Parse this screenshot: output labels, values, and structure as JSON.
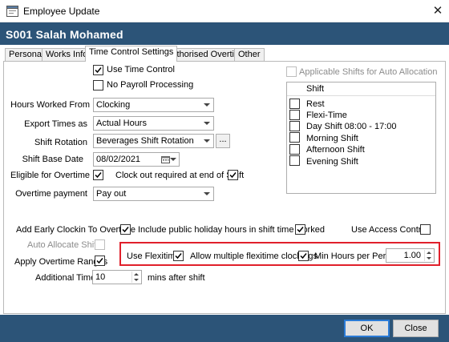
{
  "window": {
    "title": "Employee Update",
    "close_glyph": "✕",
    "icon": "app-window-icon"
  },
  "header": {
    "employee": "S001 Salah Mohamed"
  },
  "tabs": [
    "Personal",
    "Works Info",
    "Time Control Settings",
    "Authorised Overtime",
    "Other"
  ],
  "active_tab": "Time Control Settings",
  "checkboxes": {
    "use_time_control": {
      "label": "Use Time Control",
      "checked": true
    },
    "no_payroll_processing": {
      "label": "No Payroll Processing",
      "checked": false
    },
    "eligible_overtime": {
      "label": "Eligible for Overtime",
      "checked": true
    },
    "clock_out_end_shift": {
      "label": "Clock out required at end of Shift",
      "checked": true
    },
    "add_early_clockin": {
      "label": "Add Early Clockin To Overtime",
      "checked": true
    },
    "include_public_holiday": {
      "label": "Include public holiday hours in shift time worked",
      "checked": true
    },
    "use_access_control": {
      "label": "Use Access Control",
      "checked": false
    },
    "auto_allocate_shifts": {
      "label": "Auto Allocate Shifts",
      "checked": false
    },
    "apply_overtime_ranges": {
      "label": "Apply Overtime Ranges",
      "checked": true
    },
    "use_flexitime": {
      "label": "Use Flexitime",
      "checked": true
    },
    "allow_multiple_flexitime": {
      "label": "Allow multiple flexitime clockings",
      "checked": true
    },
    "applicable_shifts": {
      "label": "Applicable Shifts for Auto Allocation",
      "checked": false
    }
  },
  "fields": {
    "hours_worked_from": {
      "label": "Hours Worked From",
      "value": "Clocking"
    },
    "export_times_as": {
      "label": "Export Times as",
      "value": "Actual Hours"
    },
    "shift_rotation": {
      "label": "Shift Rotation",
      "value": "Beverages Shift Rotation",
      "browse": "..."
    },
    "shift_base_date": {
      "label": "Shift Base Date",
      "value": "08/02/2021"
    },
    "overtime_payment": {
      "label": "Overtime payment",
      "value": "Pay out"
    },
    "min_hours_per_period": {
      "label": "Min Hours per Period",
      "value": "1.00"
    },
    "additional_time": {
      "label": "Additional Time",
      "value": "10",
      "suffix": "mins after shift"
    }
  },
  "shifts": {
    "header": "Shift",
    "items": [
      "Rest",
      "Flexi-Time",
      "Day Shift 08:00 - 17:00",
      "Morning Shift",
      "Afternoon Shift",
      "Evening Shift"
    ]
  },
  "buttons": {
    "ok": "OK",
    "close": "Close"
  },
  "colors": {
    "header_bg": "#2c5478",
    "highlight_border": "#e0202b",
    "default_button_border": "#2b7bd6"
  }
}
